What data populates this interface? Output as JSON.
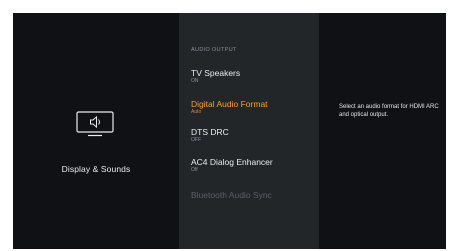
{
  "left_panel": {
    "icon": "tv-speaker-icon",
    "label": "Display & Sounds"
  },
  "menu": {
    "header": "AUDIO OUTPUT",
    "items": [
      {
        "title": "TV Speakers",
        "subtitle": "ON"
      },
      {
        "title": "Digital Audio Format",
        "subtitle": "Auto"
      },
      {
        "title": "DTS DRC",
        "subtitle": "OFF"
      },
      {
        "title": "AC4 Dialog Enhancer",
        "subtitle": "Off"
      },
      {
        "title": "Bluetooth Audio Sync",
        "subtitle": ""
      }
    ],
    "selected_index": 1
  },
  "description": {
    "text": "Select an audio format for HDMI ARC and optical output."
  },
  "colors": {
    "background": "#0f1114",
    "menu_background": "#232629",
    "accent": "#ff9d1e",
    "disabled_text": "#5b6067"
  }
}
